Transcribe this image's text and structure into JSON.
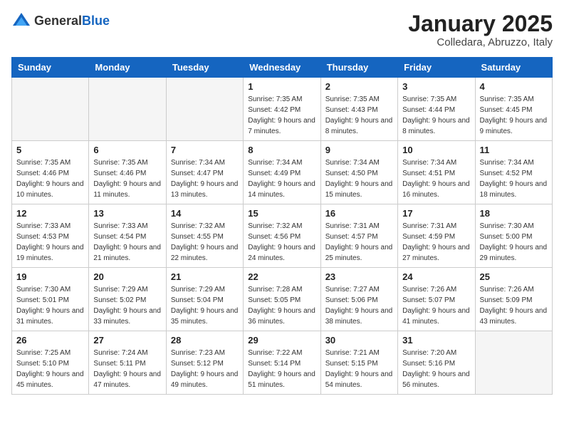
{
  "logo": {
    "general": "General",
    "blue": "Blue"
  },
  "title": "January 2025",
  "subtitle": "Colledara, Abruzzo, Italy",
  "days_of_week": [
    "Sunday",
    "Monday",
    "Tuesday",
    "Wednesday",
    "Thursday",
    "Friday",
    "Saturday"
  ],
  "weeks": [
    [
      {
        "day": "",
        "sunrise": "",
        "sunset": "",
        "daylight": "",
        "empty": true
      },
      {
        "day": "",
        "sunrise": "",
        "sunset": "",
        "daylight": "",
        "empty": true
      },
      {
        "day": "",
        "sunrise": "",
        "sunset": "",
        "daylight": "",
        "empty": true
      },
      {
        "day": "1",
        "sunrise": "Sunrise: 7:35 AM",
        "sunset": "Sunset: 4:42 PM",
        "daylight": "Daylight: 9 hours and 7 minutes."
      },
      {
        "day": "2",
        "sunrise": "Sunrise: 7:35 AM",
        "sunset": "Sunset: 4:43 PM",
        "daylight": "Daylight: 9 hours and 8 minutes."
      },
      {
        "day": "3",
        "sunrise": "Sunrise: 7:35 AM",
        "sunset": "Sunset: 4:44 PM",
        "daylight": "Daylight: 9 hours and 8 minutes."
      },
      {
        "day": "4",
        "sunrise": "Sunrise: 7:35 AM",
        "sunset": "Sunset: 4:45 PM",
        "daylight": "Daylight: 9 hours and 9 minutes."
      }
    ],
    [
      {
        "day": "5",
        "sunrise": "Sunrise: 7:35 AM",
        "sunset": "Sunset: 4:46 PM",
        "daylight": "Daylight: 9 hours and 10 minutes."
      },
      {
        "day": "6",
        "sunrise": "Sunrise: 7:35 AM",
        "sunset": "Sunset: 4:46 PM",
        "daylight": "Daylight: 9 hours and 11 minutes."
      },
      {
        "day": "7",
        "sunrise": "Sunrise: 7:34 AM",
        "sunset": "Sunset: 4:47 PM",
        "daylight": "Daylight: 9 hours and 13 minutes."
      },
      {
        "day": "8",
        "sunrise": "Sunrise: 7:34 AM",
        "sunset": "Sunset: 4:49 PM",
        "daylight": "Daylight: 9 hours and 14 minutes."
      },
      {
        "day": "9",
        "sunrise": "Sunrise: 7:34 AM",
        "sunset": "Sunset: 4:50 PM",
        "daylight": "Daylight: 9 hours and 15 minutes."
      },
      {
        "day": "10",
        "sunrise": "Sunrise: 7:34 AM",
        "sunset": "Sunset: 4:51 PM",
        "daylight": "Daylight: 9 hours and 16 minutes."
      },
      {
        "day": "11",
        "sunrise": "Sunrise: 7:34 AM",
        "sunset": "Sunset: 4:52 PM",
        "daylight": "Daylight: 9 hours and 18 minutes."
      }
    ],
    [
      {
        "day": "12",
        "sunrise": "Sunrise: 7:33 AM",
        "sunset": "Sunset: 4:53 PM",
        "daylight": "Daylight: 9 hours and 19 minutes."
      },
      {
        "day": "13",
        "sunrise": "Sunrise: 7:33 AM",
        "sunset": "Sunset: 4:54 PM",
        "daylight": "Daylight: 9 hours and 21 minutes."
      },
      {
        "day": "14",
        "sunrise": "Sunrise: 7:32 AM",
        "sunset": "Sunset: 4:55 PM",
        "daylight": "Daylight: 9 hours and 22 minutes."
      },
      {
        "day": "15",
        "sunrise": "Sunrise: 7:32 AM",
        "sunset": "Sunset: 4:56 PM",
        "daylight": "Daylight: 9 hours and 24 minutes."
      },
      {
        "day": "16",
        "sunrise": "Sunrise: 7:31 AM",
        "sunset": "Sunset: 4:57 PM",
        "daylight": "Daylight: 9 hours and 25 minutes."
      },
      {
        "day": "17",
        "sunrise": "Sunrise: 7:31 AM",
        "sunset": "Sunset: 4:59 PM",
        "daylight": "Daylight: 9 hours and 27 minutes."
      },
      {
        "day": "18",
        "sunrise": "Sunrise: 7:30 AM",
        "sunset": "Sunset: 5:00 PM",
        "daylight": "Daylight: 9 hours and 29 minutes."
      }
    ],
    [
      {
        "day": "19",
        "sunrise": "Sunrise: 7:30 AM",
        "sunset": "Sunset: 5:01 PM",
        "daylight": "Daylight: 9 hours and 31 minutes."
      },
      {
        "day": "20",
        "sunrise": "Sunrise: 7:29 AM",
        "sunset": "Sunset: 5:02 PM",
        "daylight": "Daylight: 9 hours and 33 minutes."
      },
      {
        "day": "21",
        "sunrise": "Sunrise: 7:29 AM",
        "sunset": "Sunset: 5:04 PM",
        "daylight": "Daylight: 9 hours and 35 minutes."
      },
      {
        "day": "22",
        "sunrise": "Sunrise: 7:28 AM",
        "sunset": "Sunset: 5:05 PM",
        "daylight": "Daylight: 9 hours and 36 minutes."
      },
      {
        "day": "23",
        "sunrise": "Sunrise: 7:27 AM",
        "sunset": "Sunset: 5:06 PM",
        "daylight": "Daylight: 9 hours and 38 minutes."
      },
      {
        "day": "24",
        "sunrise": "Sunrise: 7:26 AM",
        "sunset": "Sunset: 5:07 PM",
        "daylight": "Daylight: 9 hours and 41 minutes."
      },
      {
        "day": "25",
        "sunrise": "Sunrise: 7:26 AM",
        "sunset": "Sunset: 5:09 PM",
        "daylight": "Daylight: 9 hours and 43 minutes."
      }
    ],
    [
      {
        "day": "26",
        "sunrise": "Sunrise: 7:25 AM",
        "sunset": "Sunset: 5:10 PM",
        "daylight": "Daylight: 9 hours and 45 minutes."
      },
      {
        "day": "27",
        "sunrise": "Sunrise: 7:24 AM",
        "sunset": "Sunset: 5:11 PM",
        "daylight": "Daylight: 9 hours and 47 minutes."
      },
      {
        "day": "28",
        "sunrise": "Sunrise: 7:23 AM",
        "sunset": "Sunset: 5:12 PM",
        "daylight": "Daylight: 9 hours and 49 minutes."
      },
      {
        "day": "29",
        "sunrise": "Sunrise: 7:22 AM",
        "sunset": "Sunset: 5:14 PM",
        "daylight": "Daylight: 9 hours and 51 minutes."
      },
      {
        "day": "30",
        "sunrise": "Sunrise: 7:21 AM",
        "sunset": "Sunset: 5:15 PM",
        "daylight": "Daylight: 9 hours and 54 minutes."
      },
      {
        "day": "31",
        "sunrise": "Sunrise: 7:20 AM",
        "sunset": "Sunset: 5:16 PM",
        "daylight": "Daylight: 9 hours and 56 minutes."
      },
      {
        "day": "",
        "sunrise": "",
        "sunset": "",
        "daylight": "",
        "empty": true
      }
    ]
  ]
}
